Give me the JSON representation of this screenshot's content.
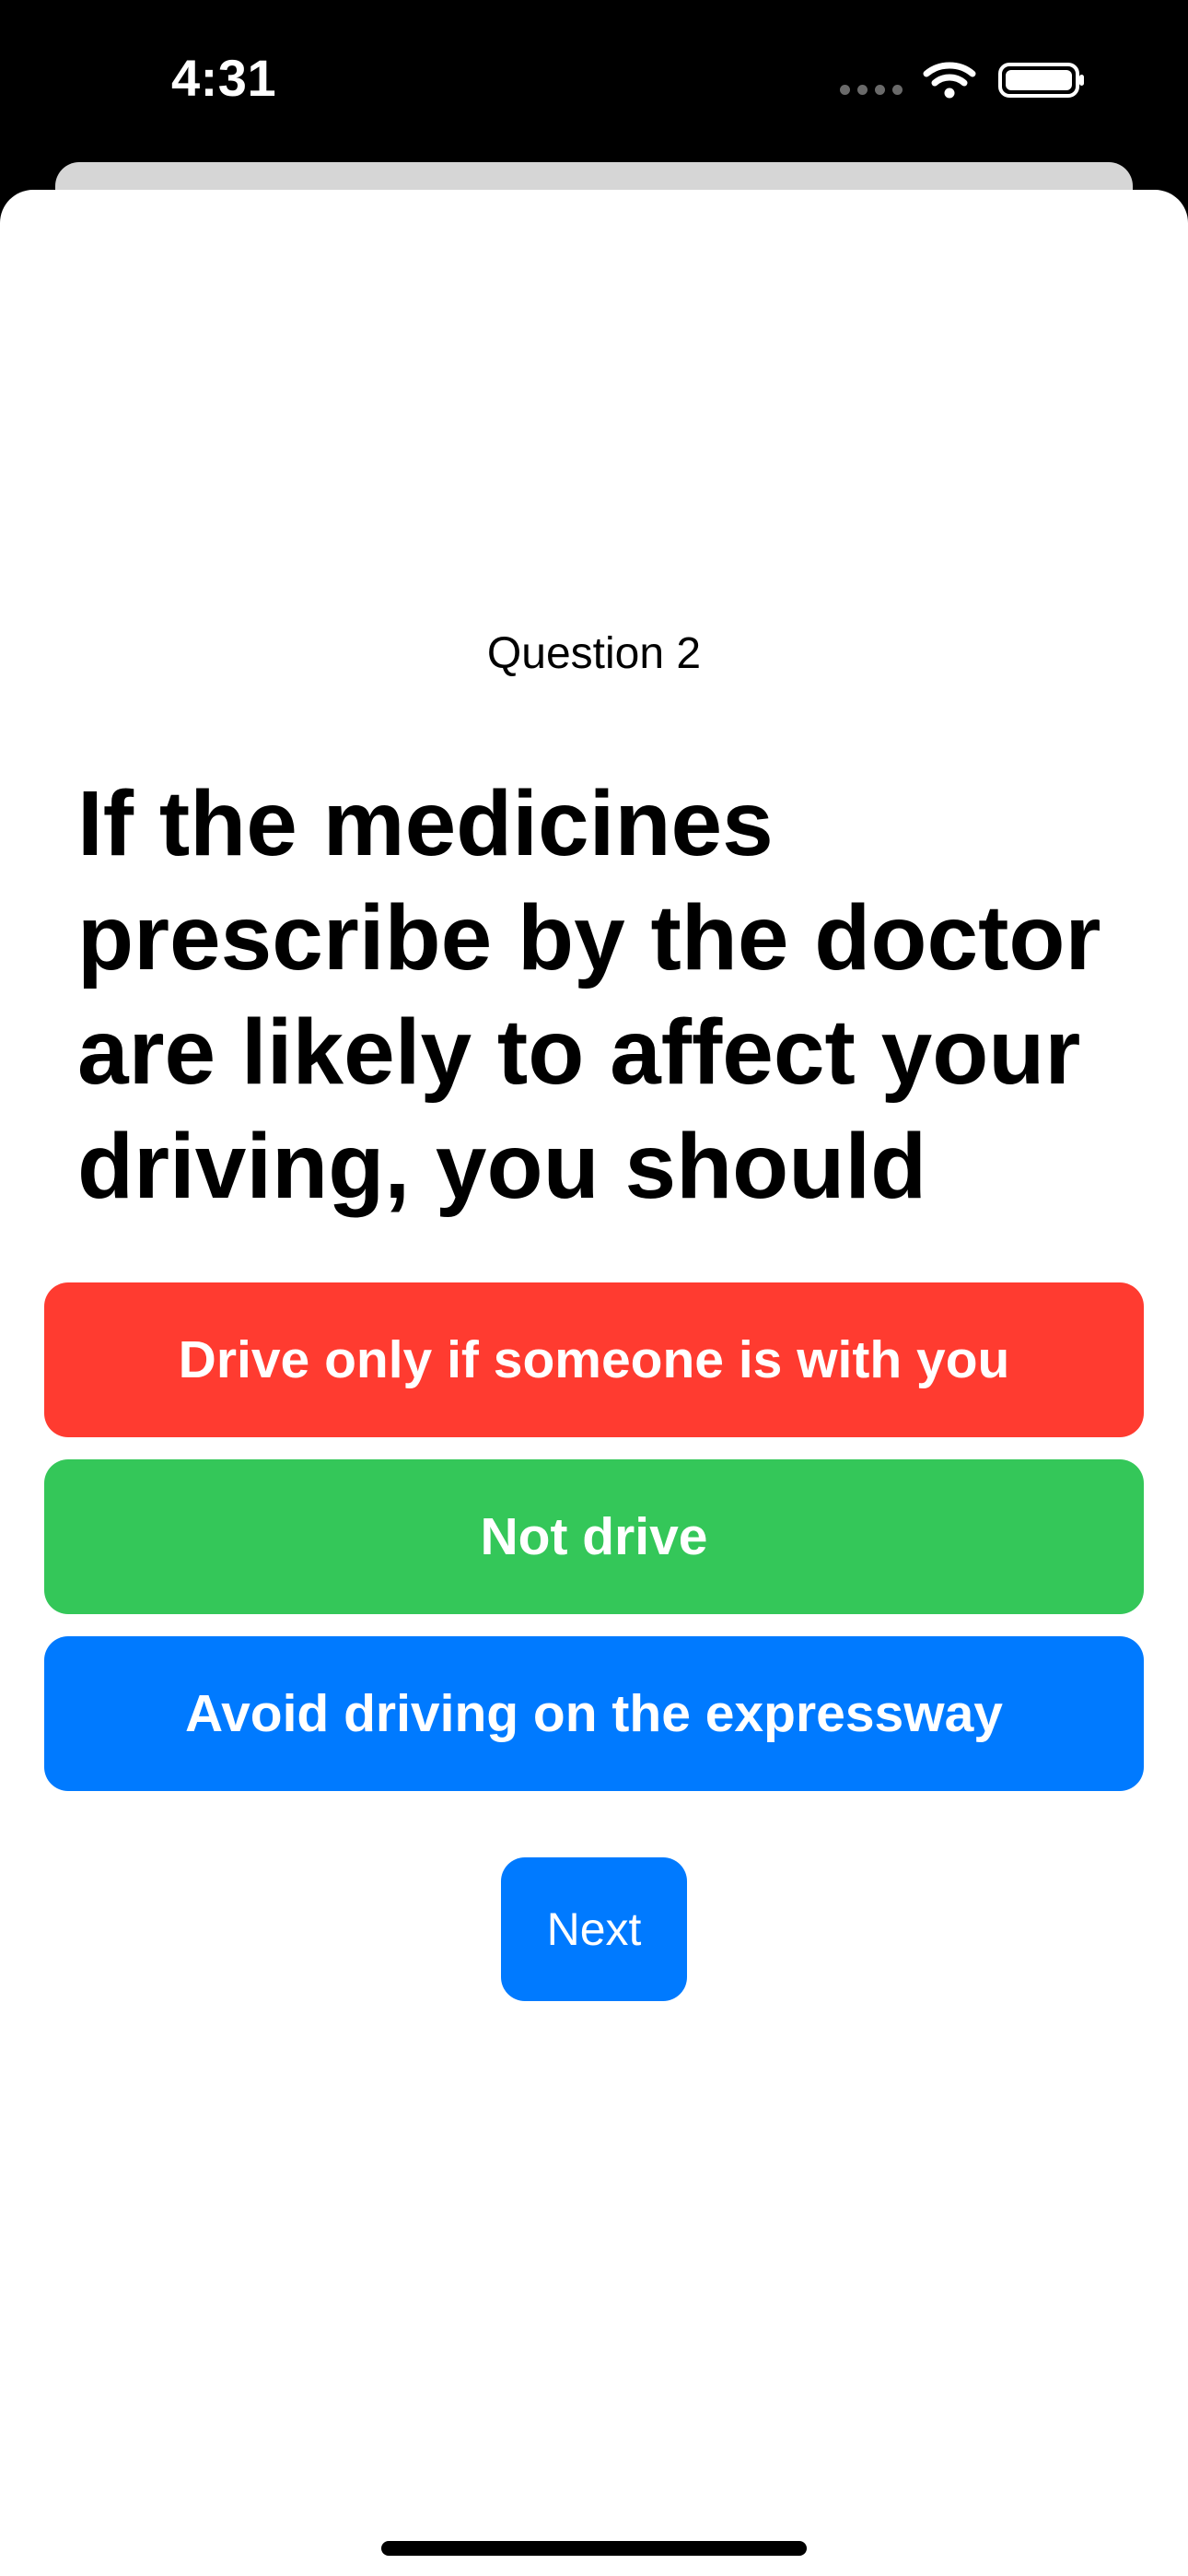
{
  "status_bar": {
    "time": "4:31",
    "wifi_icon": "wifi-icon",
    "battery_icon": "battery-icon",
    "signal_icon": "cellular-signal-icon"
  },
  "quiz": {
    "question_number": "Question 2",
    "question_text": "If the medicines prescribe by the doctor are likely to affect your driving, you should",
    "answers": [
      {
        "label": "Drive only if someone is with you",
        "color": "#ff3b30"
      },
      {
        "label": "Not drive",
        "color": "#34c759"
      },
      {
        "label": "Avoid driving on the expressway",
        "color": "#007aff"
      }
    ],
    "next_label": "Next",
    "next_color": "#007aff"
  }
}
